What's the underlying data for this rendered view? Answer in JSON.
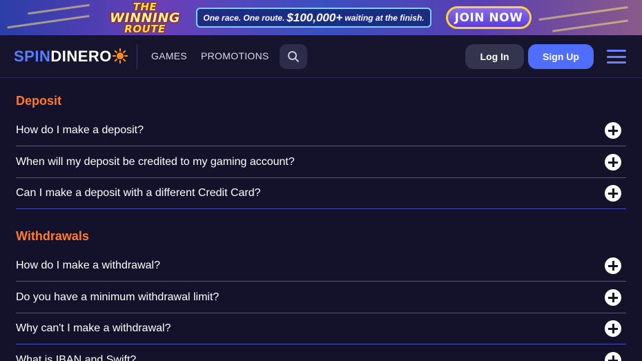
{
  "banner": {
    "logo_line1": "THE",
    "logo_line2": "WINNING",
    "logo_line3": "ROUTE",
    "tagline_pre": "One race. One route.",
    "tagline_amount": "$100,000+",
    "tagline_post": "waiting at the finish.",
    "cta_label": "JOIN NOW"
  },
  "header": {
    "logo_part1": "SPIN",
    "logo_part2": "DINERO",
    "nav": [
      {
        "label": "GAMES"
      },
      {
        "label": "PROMOTIONS"
      }
    ],
    "search_icon": "search-icon",
    "login_label": "Log In",
    "signup_label": "Sign Up",
    "menu_icon": "hamburger-menu-icon"
  },
  "colors": {
    "background": "#14122a",
    "accent_orange": "#ff7a2e",
    "brand_blue": "#4f6dff",
    "divider": "#4a55c0"
  },
  "faq": {
    "sections": [
      {
        "title": "Deposit",
        "items": [
          {
            "question": "How do I make a deposit?"
          },
          {
            "question": "When will my deposit be credited to my gaming account?"
          },
          {
            "question": "Can I make a deposit with a different Credit Card?"
          }
        ]
      },
      {
        "title": "Withdrawals",
        "items": [
          {
            "question": "How do I make a withdrawal?"
          },
          {
            "question": "Do you have a minimum withdrawal limit?"
          },
          {
            "question": "Why can't I make a withdrawal?"
          },
          {
            "question": "What is IBAN and Swift?"
          }
        ]
      }
    ],
    "expand_icon": "plus-circle-icon"
  }
}
